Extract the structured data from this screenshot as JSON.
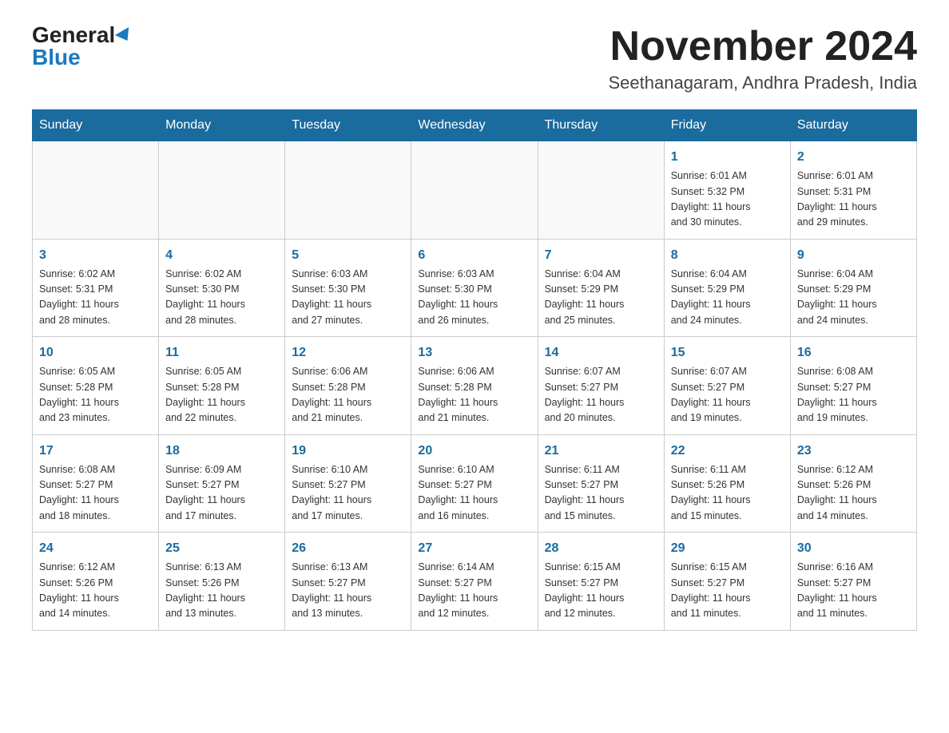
{
  "logo": {
    "general": "General",
    "blue": "Blue"
  },
  "header": {
    "month": "November 2024",
    "location": "Seethanagaram, Andhra Pradesh, India"
  },
  "weekdays": [
    "Sunday",
    "Monday",
    "Tuesday",
    "Wednesday",
    "Thursday",
    "Friday",
    "Saturday"
  ],
  "weeks": [
    [
      {
        "day": "",
        "info": ""
      },
      {
        "day": "",
        "info": ""
      },
      {
        "day": "",
        "info": ""
      },
      {
        "day": "",
        "info": ""
      },
      {
        "day": "",
        "info": ""
      },
      {
        "day": "1",
        "info": "Sunrise: 6:01 AM\nSunset: 5:32 PM\nDaylight: 11 hours\nand 30 minutes."
      },
      {
        "day": "2",
        "info": "Sunrise: 6:01 AM\nSunset: 5:31 PM\nDaylight: 11 hours\nand 29 minutes."
      }
    ],
    [
      {
        "day": "3",
        "info": "Sunrise: 6:02 AM\nSunset: 5:31 PM\nDaylight: 11 hours\nand 28 minutes."
      },
      {
        "day": "4",
        "info": "Sunrise: 6:02 AM\nSunset: 5:30 PM\nDaylight: 11 hours\nand 28 minutes."
      },
      {
        "day": "5",
        "info": "Sunrise: 6:03 AM\nSunset: 5:30 PM\nDaylight: 11 hours\nand 27 minutes."
      },
      {
        "day": "6",
        "info": "Sunrise: 6:03 AM\nSunset: 5:30 PM\nDaylight: 11 hours\nand 26 minutes."
      },
      {
        "day": "7",
        "info": "Sunrise: 6:04 AM\nSunset: 5:29 PM\nDaylight: 11 hours\nand 25 minutes."
      },
      {
        "day": "8",
        "info": "Sunrise: 6:04 AM\nSunset: 5:29 PM\nDaylight: 11 hours\nand 24 minutes."
      },
      {
        "day": "9",
        "info": "Sunrise: 6:04 AM\nSunset: 5:29 PM\nDaylight: 11 hours\nand 24 minutes."
      }
    ],
    [
      {
        "day": "10",
        "info": "Sunrise: 6:05 AM\nSunset: 5:28 PM\nDaylight: 11 hours\nand 23 minutes."
      },
      {
        "day": "11",
        "info": "Sunrise: 6:05 AM\nSunset: 5:28 PM\nDaylight: 11 hours\nand 22 minutes."
      },
      {
        "day": "12",
        "info": "Sunrise: 6:06 AM\nSunset: 5:28 PM\nDaylight: 11 hours\nand 21 minutes."
      },
      {
        "day": "13",
        "info": "Sunrise: 6:06 AM\nSunset: 5:28 PM\nDaylight: 11 hours\nand 21 minutes."
      },
      {
        "day": "14",
        "info": "Sunrise: 6:07 AM\nSunset: 5:27 PM\nDaylight: 11 hours\nand 20 minutes."
      },
      {
        "day": "15",
        "info": "Sunrise: 6:07 AM\nSunset: 5:27 PM\nDaylight: 11 hours\nand 19 minutes."
      },
      {
        "day": "16",
        "info": "Sunrise: 6:08 AM\nSunset: 5:27 PM\nDaylight: 11 hours\nand 19 minutes."
      }
    ],
    [
      {
        "day": "17",
        "info": "Sunrise: 6:08 AM\nSunset: 5:27 PM\nDaylight: 11 hours\nand 18 minutes."
      },
      {
        "day": "18",
        "info": "Sunrise: 6:09 AM\nSunset: 5:27 PM\nDaylight: 11 hours\nand 17 minutes."
      },
      {
        "day": "19",
        "info": "Sunrise: 6:10 AM\nSunset: 5:27 PM\nDaylight: 11 hours\nand 17 minutes."
      },
      {
        "day": "20",
        "info": "Sunrise: 6:10 AM\nSunset: 5:27 PM\nDaylight: 11 hours\nand 16 minutes."
      },
      {
        "day": "21",
        "info": "Sunrise: 6:11 AM\nSunset: 5:27 PM\nDaylight: 11 hours\nand 15 minutes."
      },
      {
        "day": "22",
        "info": "Sunrise: 6:11 AM\nSunset: 5:26 PM\nDaylight: 11 hours\nand 15 minutes."
      },
      {
        "day": "23",
        "info": "Sunrise: 6:12 AM\nSunset: 5:26 PM\nDaylight: 11 hours\nand 14 minutes."
      }
    ],
    [
      {
        "day": "24",
        "info": "Sunrise: 6:12 AM\nSunset: 5:26 PM\nDaylight: 11 hours\nand 14 minutes."
      },
      {
        "day": "25",
        "info": "Sunrise: 6:13 AM\nSunset: 5:26 PM\nDaylight: 11 hours\nand 13 minutes."
      },
      {
        "day": "26",
        "info": "Sunrise: 6:13 AM\nSunset: 5:27 PM\nDaylight: 11 hours\nand 13 minutes."
      },
      {
        "day": "27",
        "info": "Sunrise: 6:14 AM\nSunset: 5:27 PM\nDaylight: 11 hours\nand 12 minutes."
      },
      {
        "day": "28",
        "info": "Sunrise: 6:15 AM\nSunset: 5:27 PM\nDaylight: 11 hours\nand 12 minutes."
      },
      {
        "day": "29",
        "info": "Sunrise: 6:15 AM\nSunset: 5:27 PM\nDaylight: 11 hours\nand 11 minutes."
      },
      {
        "day": "30",
        "info": "Sunrise: 6:16 AM\nSunset: 5:27 PM\nDaylight: 11 hours\nand 11 minutes."
      }
    ]
  ]
}
